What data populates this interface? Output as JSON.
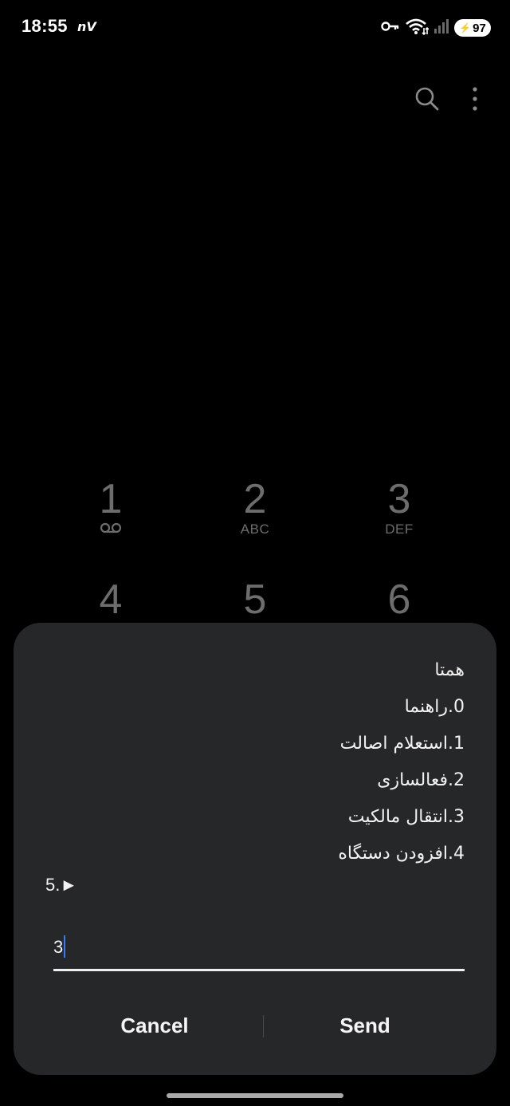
{
  "status_bar": {
    "time": "18:55",
    "carrier_icon_text": "nV",
    "battery_level": "97",
    "icons": [
      "key-icon",
      "wifi-icon",
      "signal-icon",
      "battery-icon"
    ]
  },
  "top_actions": {
    "icons": [
      "search-icon",
      "more-options-icon"
    ]
  },
  "dialpad": {
    "keys": [
      {
        "digit": "1",
        "letters": ""
      },
      {
        "digit": "2",
        "letters": "ABC"
      },
      {
        "digit": "3",
        "letters": "DEF"
      },
      {
        "digit": "4",
        "letters": ""
      },
      {
        "digit": "5",
        "letters": ""
      },
      {
        "digit": "6",
        "letters": ""
      }
    ]
  },
  "dialog": {
    "lines": [
      "همتا",
      "0.راهنما",
      "1.استعلام اصالت",
      "2.فعالسازی",
      "3.انتقال مالکیت",
      "4.افزودن دستگاه"
    ],
    "extra_line": "5.►",
    "input_value": "3",
    "cancel_label": "Cancel",
    "send_label": "Send"
  },
  "colors": {
    "background": "#000000",
    "dialog": "#262728",
    "caret": "#3b78ff",
    "dialpad_text": "#6d6d6d"
  }
}
